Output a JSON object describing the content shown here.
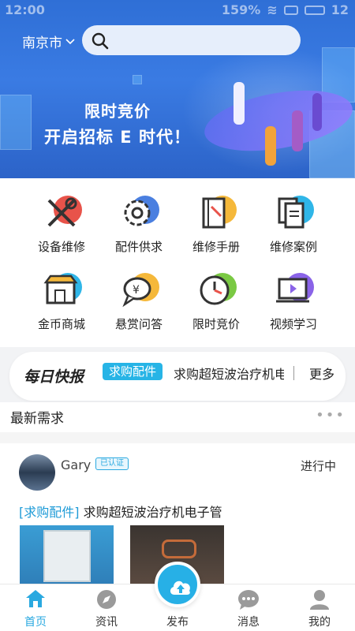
{
  "status_bar": {
    "time": "12:00",
    "battery": "159%",
    "right_num": "12"
  },
  "header": {
    "city": "南京市",
    "search_placeholder": ""
  },
  "banner": {
    "slogan_line1": "限时竞价",
    "slogan_line2": "开启招标 E 时代！"
  },
  "menu": {
    "items": [
      {
        "label": "设备维修",
        "icon": "tools-icon",
        "color": "#e8534a"
      },
      {
        "label": "配件供求",
        "icon": "gear-icon",
        "color": "#4a7fe0"
      },
      {
        "label": "维修手册",
        "icon": "manual-icon",
        "color": "#f5b83a"
      },
      {
        "label": "维修案例",
        "icon": "document-icon",
        "color": "#2fb6e8"
      },
      {
        "label": "金币商城",
        "icon": "shop-icon",
        "color": "#2fb6e8"
      },
      {
        "label": "悬赏问答",
        "icon": "qa-icon",
        "color": "#f5b83a"
      },
      {
        "label": "限时竞价",
        "icon": "clock-icon",
        "color": "#7ac943"
      },
      {
        "label": "视频学习",
        "icon": "video-icon",
        "color": "#8a63e8"
      }
    ]
  },
  "news": {
    "title": "每日快报",
    "tag": "求购配件",
    "text": "求购超短波治疗机电子管",
    "more": "更多"
  },
  "latest": {
    "title": "最新需求"
  },
  "card": {
    "user": "Gary",
    "verified": "已认证",
    "status": "进行中",
    "category": "[求购配件]",
    "title": "求购超短波治疗机电子管"
  },
  "tabbar": {
    "items": [
      {
        "label": "首页",
        "icon": "home-icon",
        "active": true
      },
      {
        "label": "资讯",
        "icon": "compass-icon",
        "active": false
      },
      {
        "label": "发布",
        "icon": "upload-cloud-icon",
        "active": false
      },
      {
        "label": "消息",
        "icon": "chat-icon",
        "active": false
      },
      {
        "label": "我的",
        "icon": "user-icon",
        "active": false
      }
    ]
  },
  "colors": {
    "accent": "#27b0e6",
    "banner": "#3a7be3"
  }
}
